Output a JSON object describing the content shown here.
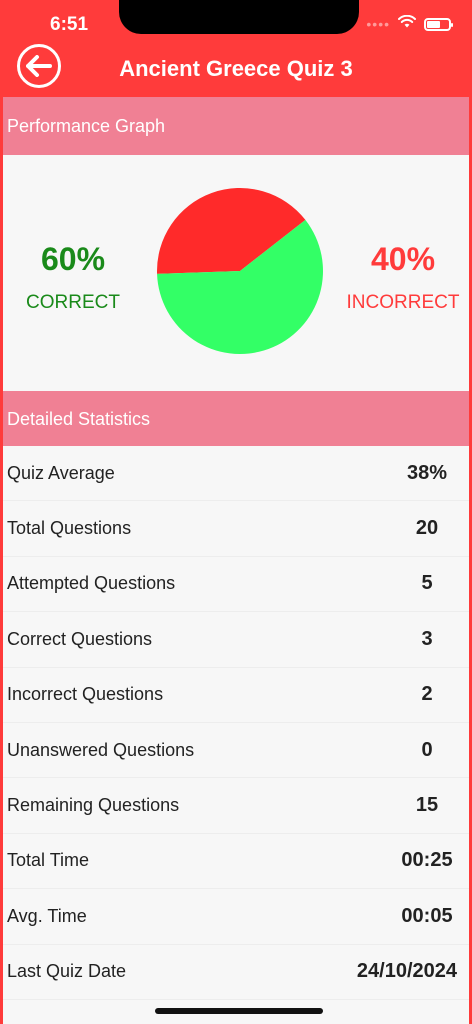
{
  "status": {
    "time": "6:51"
  },
  "header": {
    "title": "Ancient Greece Quiz 3"
  },
  "graph": {
    "section_title": "Performance Graph",
    "correct_pct": "60%",
    "correct_label": "CORRECT",
    "incorrect_pct": "40%",
    "incorrect_label": "INCORRECT",
    "correct_fraction": 0.6,
    "colors": {
      "correct": "#33ff66",
      "incorrect": "#ff2a2a"
    }
  },
  "stats": {
    "section_title": "Detailed Statistics",
    "rows": [
      {
        "label": "Quiz Average",
        "value": "38%"
      },
      {
        "label": "Total Questions",
        "value": "20"
      },
      {
        "label": "Attempted Questions",
        "value": "5"
      },
      {
        "label": "Correct Questions",
        "value": "3"
      },
      {
        "label": "Incorrect Questions",
        "value": "2"
      },
      {
        "label": "Unanswered Questions",
        "value": "0"
      },
      {
        "label": "Remaining Questions",
        "value": "15"
      },
      {
        "label": "Total Time",
        "value": "00:25"
      },
      {
        "label": "Avg. Time",
        "value": "00:05"
      },
      {
        "label": "Last Quiz Date",
        "value": "24/10/2024"
      }
    ]
  },
  "theme": {
    "accent": "#ff3b3b",
    "section_bg": "#f08094"
  }
}
